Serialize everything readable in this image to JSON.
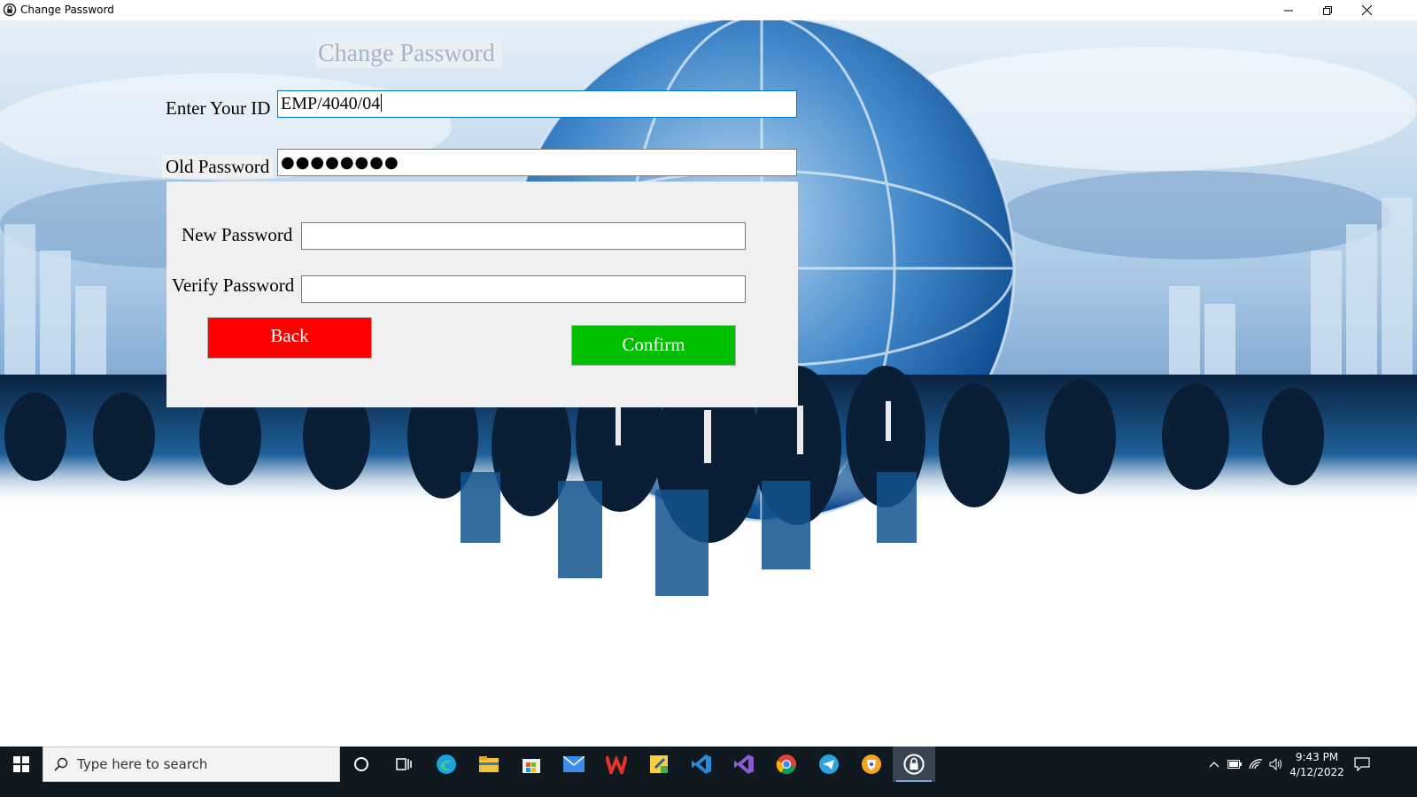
{
  "window": {
    "title": "Change Password",
    "app_icon": "lock-refresh-icon",
    "controls": [
      "minimize-icon",
      "restore-icon",
      "close-icon"
    ]
  },
  "form": {
    "heading": "Change Password",
    "id_label": "Enter Your ID",
    "id_value": "EMP/4040/04",
    "old_password_label": "Old Password",
    "old_password_value": "●●●●●●●●",
    "new_password_label": "New Password",
    "new_password_value": "",
    "verify_password_label": "Verify Password",
    "verify_password_value": "",
    "back_label": "Back",
    "confirm_label": "Confirm"
  },
  "colors": {
    "back_button": "#ff0000",
    "confirm_button": "#00c000",
    "panel": "#f0f0f0"
  },
  "taskbar": {
    "search_placeholder": "Type here to search",
    "time": "9:43 PM",
    "date": "4/12/2022",
    "pinned": [
      "cortana-icon",
      "task-view-icon",
      "edge-icon",
      "file-explorer-icon",
      "store-icon",
      "mail-icon",
      "wps-office-icon",
      "sticky-notes-icon",
      "vscode-icon",
      "visual-studio-icon",
      "chrome-icon",
      "telegram-icon",
      "brave-icon",
      "change-password-app-icon"
    ]
  }
}
